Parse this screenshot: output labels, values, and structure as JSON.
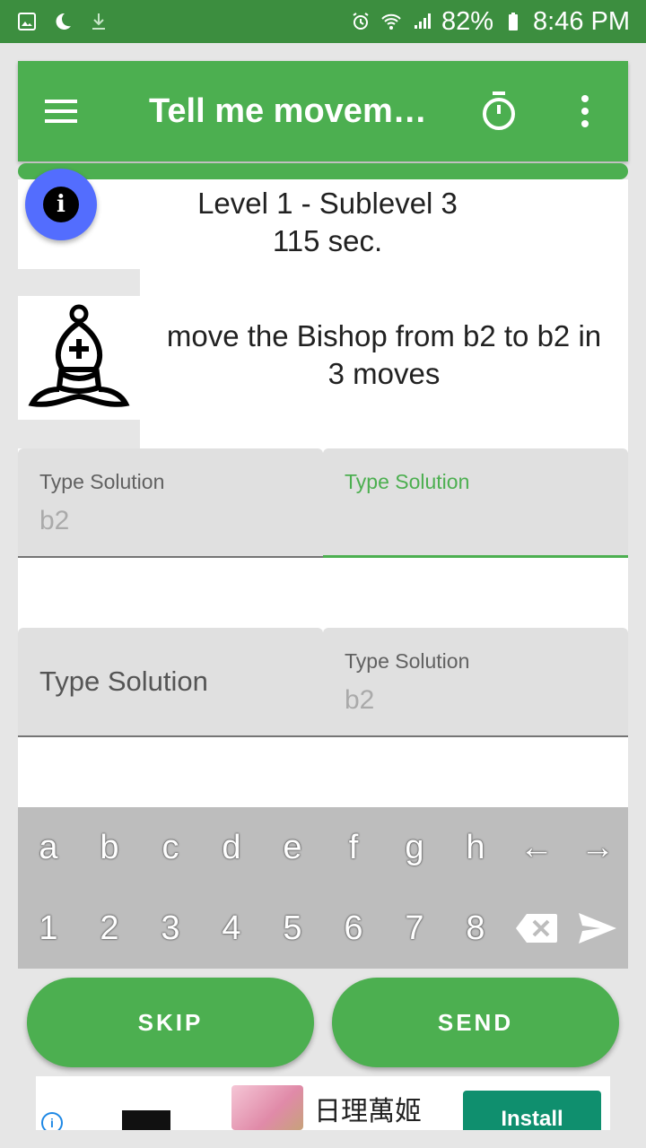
{
  "status_bar": {
    "battery": "82%",
    "time": "8:46 PM",
    "icons": [
      "image-icon",
      "moon-icon",
      "download-icon",
      "alarm-icon",
      "wifi-icon",
      "signal-icon",
      "battery-icon"
    ]
  },
  "toolbar": {
    "title": "Tell me moveme...",
    "icons": [
      "menu-icon",
      "stopwatch-icon",
      "more-vert-icon"
    ]
  },
  "colors": {
    "primary": "#4caf50",
    "primary_dark": "#3c8e3f",
    "fab": "#536dfe"
  },
  "info_icon": "i",
  "level": {
    "line1": "Level 1 - Sublevel 3",
    "line2": "115 sec."
  },
  "instruction": {
    "line1": "move the Bishop from b2 to b2 in",
    "line2": "3 moves"
  },
  "fields": [
    {
      "label": "Type Solution",
      "hint": "b2",
      "state": "filled-label"
    },
    {
      "label": "Type Solution",
      "hint": "",
      "state": "active"
    },
    {
      "label": "Type Solution",
      "hint": "",
      "state": "empty"
    },
    {
      "label": "Type Solution",
      "hint": "b2",
      "state": "filled-label"
    }
  ],
  "keyboard": {
    "row1": [
      "a",
      "b",
      "c",
      "d",
      "e",
      "f",
      "g",
      "h",
      "←",
      "→"
    ],
    "row2": [
      "1",
      "2",
      "3",
      "4",
      "5",
      "6",
      "7",
      "8"
    ]
  },
  "buttons": {
    "skip": "SKIP",
    "send": "SEND"
  },
  "ad": {
    "info": "i",
    "title": "日理萬姬",
    "install": "Install"
  }
}
